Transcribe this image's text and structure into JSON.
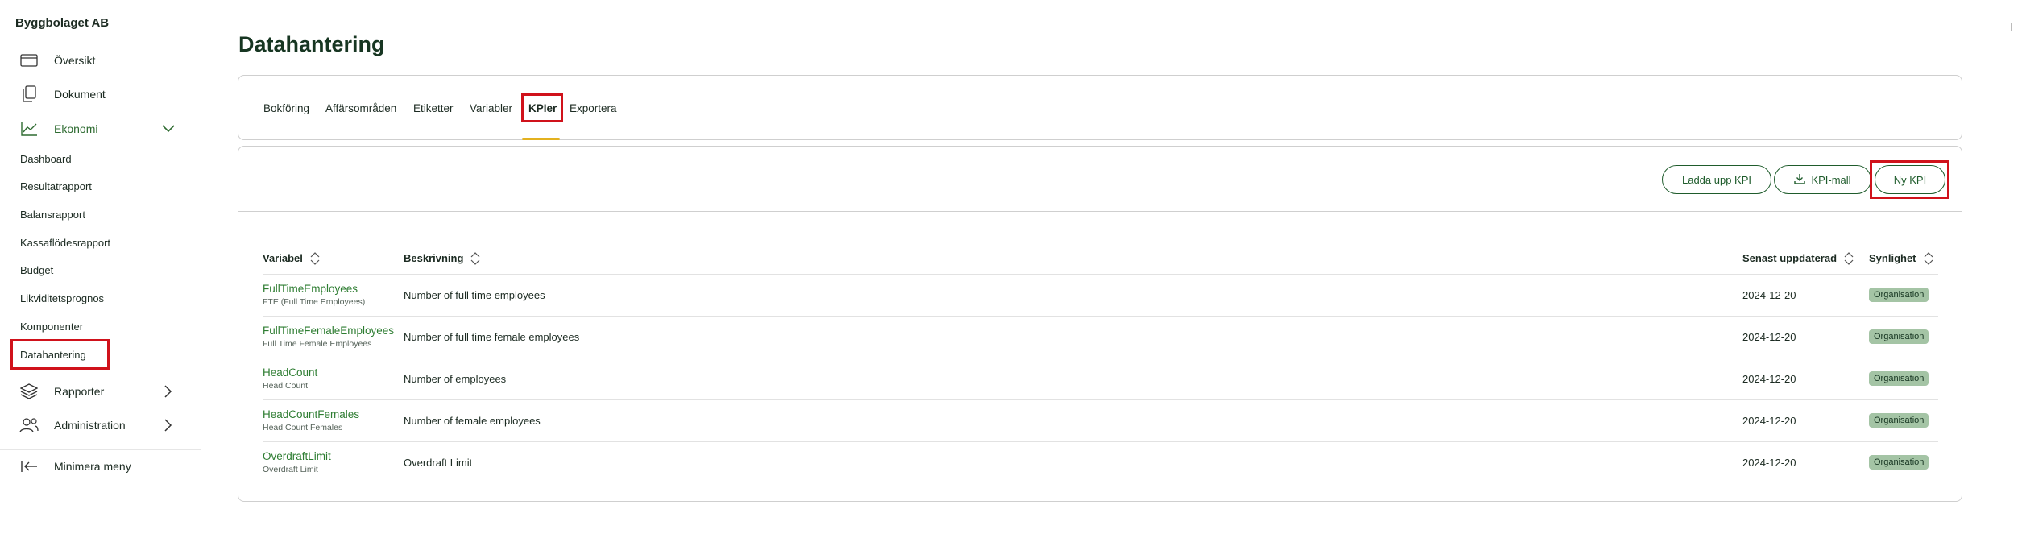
{
  "sidebar": {
    "company": "Byggbolaget AB",
    "items": [
      {
        "label": "Översikt",
        "icon": "dashboard-icon"
      },
      {
        "label": "Dokument",
        "icon": "documents-icon"
      },
      {
        "label": "Ekonomi",
        "icon": "chart-line-icon"
      }
    ],
    "sub_items": [
      "Dashboard",
      "Resultatrapport",
      "Balansrapport",
      "Kassaflödesrapport",
      "Budget",
      "Likviditetsprognos",
      "Komponenter",
      "Datahantering"
    ],
    "lower_items": [
      {
        "label": "Rapporter",
        "icon": "layers-icon"
      },
      {
        "label": "Administration",
        "icon": "users-icon"
      }
    ],
    "minimize_label": "Minimera meny"
  },
  "page": {
    "title": "Datahantering"
  },
  "tabs": [
    "Bokföring",
    "Affärsområden",
    "Etiketter",
    "Variabler",
    "KPIer",
    "Exportera"
  ],
  "active_tab": "KPIer",
  "toolbar": {
    "upload_label": "Ladda upp KPI",
    "template_label": "KPI-mall",
    "new_label": "Ny KPI"
  },
  "table": {
    "headers": {
      "variable": "Variabel",
      "description": "Beskrivning",
      "updated": "Senast uppdaterad",
      "visibility": "Synlighet"
    },
    "rows": [
      {
        "name": "FullTimeEmployees",
        "sub": "FTE (Full Time Employees)",
        "description": "Number of full time employees",
        "updated": "2024-12-20",
        "visibility": "Organisation"
      },
      {
        "name": "FullTimeFemaleEmployees",
        "sub": "Full Time Female Employees",
        "description": "Number of full time female employees",
        "updated": "2024-12-20",
        "visibility": "Organisation"
      },
      {
        "name": "HeadCount",
        "sub": "Head Count",
        "description": "Number of employees",
        "updated": "2024-12-20",
        "visibility": "Organisation"
      },
      {
        "name": "HeadCountFemales",
        "sub": "Head Count Females",
        "description": "Number of female employees",
        "updated": "2024-12-20",
        "visibility": "Organisation"
      },
      {
        "name": "OverdraftLimit",
        "sub": "Overdraft Limit",
        "description": "Overdraft Limit",
        "updated": "2024-12-20",
        "visibility": "Organisation"
      }
    ]
  },
  "colors": {
    "accent_green": "#2e7d32",
    "tab_underline": "#e3b11f",
    "highlight_red": "#d0121b",
    "badge_bg": "#a4c4a5"
  }
}
